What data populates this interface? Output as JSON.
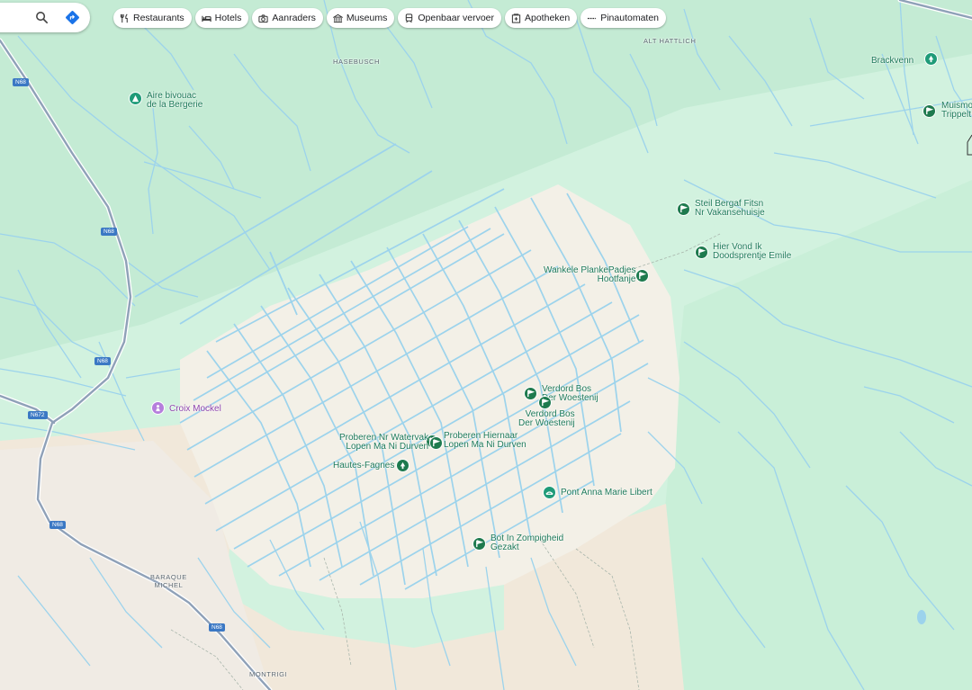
{
  "search": {
    "search_icon": "search-icon",
    "directions_icon": "directions-icon"
  },
  "categories": [
    {
      "label": "Restaurants",
      "icon": "fork-knife-icon"
    },
    {
      "label": "Hotels",
      "icon": "bed-icon"
    },
    {
      "label": "Aanraders",
      "icon": "camera-icon"
    },
    {
      "label": "Museums",
      "icon": "museum-icon"
    },
    {
      "label": "Openbaar vervoer",
      "icon": "train-icon"
    },
    {
      "label": "Apotheken",
      "icon": "pharmacy-icon"
    },
    {
      "label": "Pinautomaten",
      "icon": "atm-icon"
    }
  ],
  "places": {
    "alt_hattlich": "ALT HATTLICH",
    "hasebusch": "HASEBUSCH",
    "baraque_michel": "BARAQUE\nMICHEL",
    "montrigi": "MONTRIGI"
  },
  "roads": {
    "n68": "N68",
    "n672": "N672"
  },
  "pois": {
    "aire_bivouac": "Aire bivouac\nde la Bergerie",
    "brackvenn": "Brackvenn",
    "muismo": "Muismo\nTrippelt",
    "steil_bergaf": "Steil Bergaf Fitsn\nNr Vakansehuisje",
    "hier_vond": "Hier Vond Ik\nDoodsprentje Emile",
    "wankele": "Wankele PlankePadjes\nHootfanje",
    "croix_mockel": "Croix Mockel",
    "verdord1": "Verdord Bos\nDer Woestenij",
    "verdord2": "Verdord Bos\nDer Woestenij",
    "proberen_water": "Proberen Nr Watervak\nLopen Ma Ni Durven",
    "proberen_hier": "Proberen Hiernaar\nLopen Ma Ni Durven",
    "hautes_fagnes": "Hautes-Fagnes",
    "pont_anna": "Pont Anna Marie Libert",
    "bot_in": "Bot In Zompigheid\nGezakt"
  },
  "colors": {
    "park": "#c2edd6",
    "heath": "#f2efe6",
    "sand": "#f0e6d8",
    "water": "#9cd3ec",
    "road": "#8fa1b8",
    "pin": "#1e7a4e",
    "label": "#1e7a5a"
  }
}
